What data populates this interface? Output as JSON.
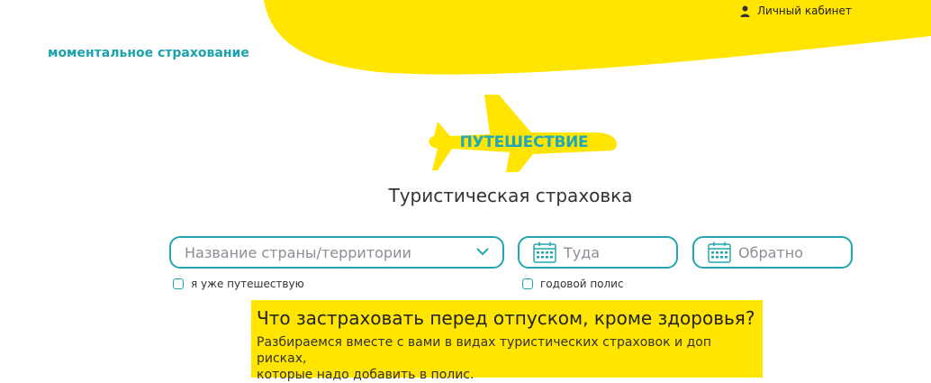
{
  "header": {
    "account_link": "Личный кабинет",
    "brand": "моментальное страхование",
    "user_icon": "user-icon"
  },
  "hero": {
    "plane_label": "ПУТЕШЕСТВИЕ",
    "title": "Туристическая страховка"
  },
  "form": {
    "country_placeholder": "Название страны/территории",
    "from_placeholder": "Туда",
    "to_placeholder": "Обратно",
    "already_traveling": "я уже путешествую",
    "annual_policy": "годовой полис",
    "calendar_icon": "calendar-icon",
    "dropdown_icon": "chevron-down-icon"
  },
  "banner": {
    "title": "Что застраховать перед отпуском, кроме здоровья?",
    "text_line1": "Разбираемся вместе с вами в видах туристических страховок и доп рисках,",
    "text_line2": "которые надо добавить в полис."
  },
  "colors": {
    "yellow": "#ffe500",
    "teal": "#1aa3ad"
  }
}
